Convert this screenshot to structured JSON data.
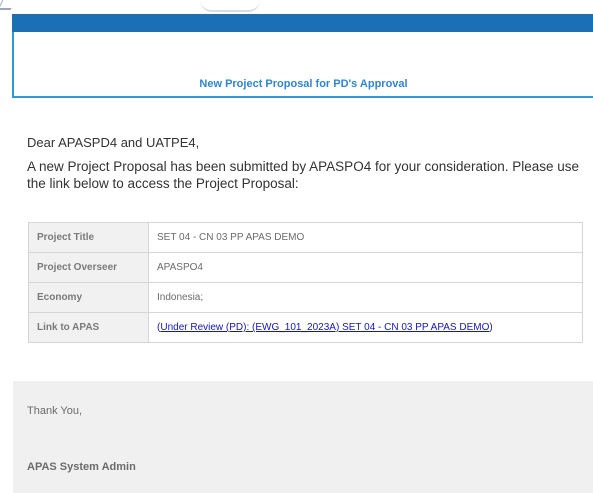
{
  "header": {
    "title": "New Project Proposal for PD's Approval"
  },
  "message": {
    "greeting": "Dear APASPD4 and UATPE4,",
    "body": "A new Project Proposal has been submitted by APASPO4  for your consideration. Please use the link below to access the Project Proposal:"
  },
  "details": {
    "rows": [
      {
        "label": "Project Title",
        "value": "SET 04 - CN 03 PP APAS DEMO"
      },
      {
        "label": "Project Overseer",
        "value": "APASPO4"
      },
      {
        "label": "Economy",
        "value": "Indonesia;"
      },
      {
        "label": "Link to APAS",
        "value": "Under Review (PD): (EWG_101_2023A) SET 04 - CN 03 PP APAS DEMO"
      }
    ]
  },
  "footer": {
    "thanks": "Thank You,",
    "signature": "APAS System Admin"
  },
  "colors": {
    "header_bar": "#1b6fb4",
    "header_accent": "#2f9bd6",
    "title_text": "#2b86d3",
    "link": "#1515c8",
    "footer_bg": "#f0f0f0"
  }
}
